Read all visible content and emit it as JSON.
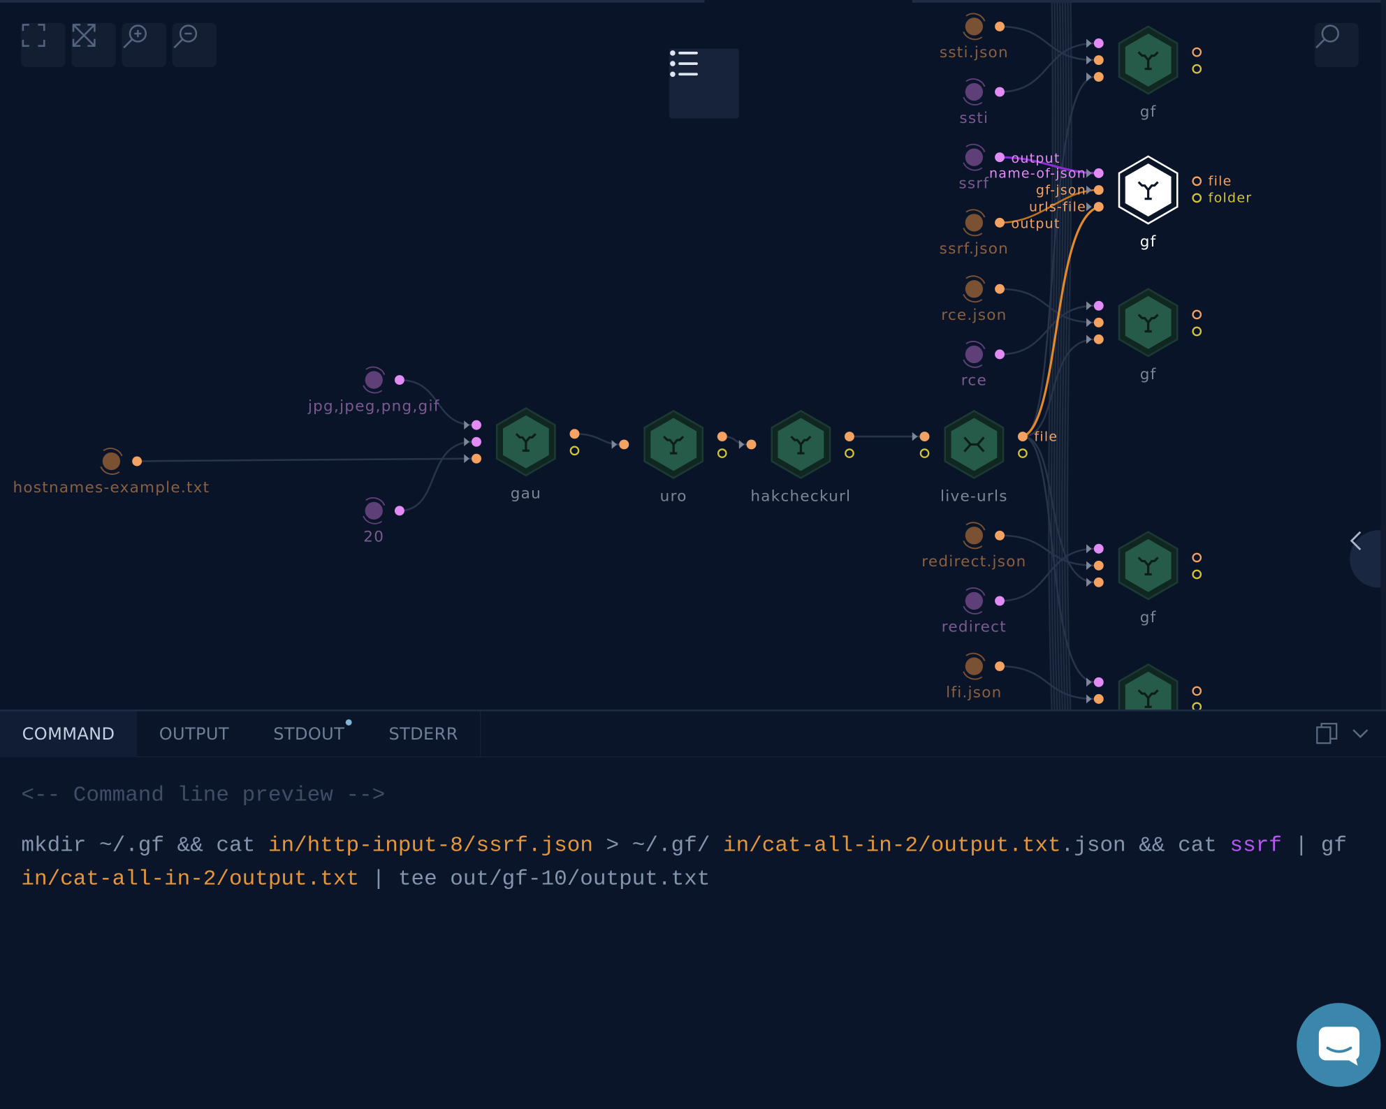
{
  "toolbar": {
    "buttons": [
      {
        "name": "fit-view",
        "icon": "expand-corners-icon"
      },
      {
        "name": "fullscreen",
        "icon": "arrows-diagonal-icon"
      },
      {
        "name": "zoom-in",
        "icon": "zoom-in-icon"
      },
      {
        "name": "zoom-out",
        "icon": "zoom-out-icon"
      }
    ],
    "menu_icon": "list-icon",
    "search_icon": "search-icon",
    "collapse_icon": "chevron-left-icon"
  },
  "colors": {
    "background": "#0a1428",
    "file_port": "#f4a261",
    "param_port": "#e28bf5",
    "folder_port": "#d4c43a",
    "node_fill": "#265b49",
    "edge_active": "#e38b2c",
    "command_highlight": "#e3973a",
    "command_param": "#b458f0"
  },
  "graph": {
    "inputs": [
      {
        "id": "ssti_json",
        "label": "ssti.json",
        "kind": "file"
      },
      {
        "id": "ssti",
        "label": "ssti",
        "kind": "param"
      },
      {
        "id": "ssrf",
        "label": "ssrf",
        "kind": "param",
        "port_label": "output"
      },
      {
        "id": "ssrf_json",
        "label": "ssrf.json",
        "kind": "file",
        "port_label": "output"
      },
      {
        "id": "rce_json",
        "label": "rce.json",
        "kind": "file"
      },
      {
        "id": "rce",
        "label": "rce",
        "kind": "param"
      },
      {
        "id": "ext",
        "label": "jpg,jpeg,png,gif",
        "kind": "param"
      },
      {
        "id": "hosts",
        "label": "hostnames-example.txt",
        "kind": "file"
      },
      {
        "id": "threads",
        "label": "20",
        "kind": "param"
      },
      {
        "id": "redirect_json",
        "label": "redirect.json",
        "kind": "file"
      },
      {
        "id": "redirect",
        "label": "redirect",
        "kind": "param"
      },
      {
        "id": "lfi_json",
        "label": "lfi.json",
        "kind": "file"
      }
    ],
    "nodes": [
      {
        "id": "gf1",
        "label": "gf"
      },
      {
        "id": "gf2",
        "label": "gf",
        "selected": true,
        "input_labels": [
          "name-of-json",
          "gf-json",
          "urls-file"
        ],
        "output_labels": [
          "file",
          "folder"
        ]
      },
      {
        "id": "gf3",
        "label": "gf"
      },
      {
        "id": "gau",
        "label": "gau"
      },
      {
        "id": "uro",
        "label": "uro"
      },
      {
        "id": "hak",
        "label": "hakcheckurl"
      },
      {
        "id": "live",
        "label": "live-urls",
        "output_labels": [
          "file"
        ]
      },
      {
        "id": "gf4",
        "label": "gf"
      },
      {
        "id": "gf5",
        "label": "gf"
      }
    ]
  },
  "panel": {
    "tabs": [
      {
        "label": "COMMAND",
        "active": true
      },
      {
        "label": "OUTPUT"
      },
      {
        "label": "STDOUT",
        "badge": true
      },
      {
        "label": "STDERR"
      }
    ],
    "copy_icon": "copy-icon",
    "collapse_icon": "chevron-down-icon",
    "comment": "<-- Command line preview -->",
    "command": [
      {
        "t": "mkdir ~/.gf && cat "
      },
      {
        "t": "in/http-input-8/ssrf.json",
        "c": "hl"
      },
      {
        "t": " > ~/.gf/ "
      },
      {
        "t": "in/cat-all-in-2/output.txt",
        "c": "hl"
      },
      {
        "t": ".json && cat "
      },
      {
        "t": "ssrf",
        "c": "pv"
      },
      {
        "t": " | gf "
      },
      {
        "t": "in/cat-all-in-2/output.txt",
        "c": "hl"
      },
      {
        "t": " | tee out/gf-10/output.txt"
      }
    ]
  },
  "chat_icon": "chat-bubble-icon"
}
